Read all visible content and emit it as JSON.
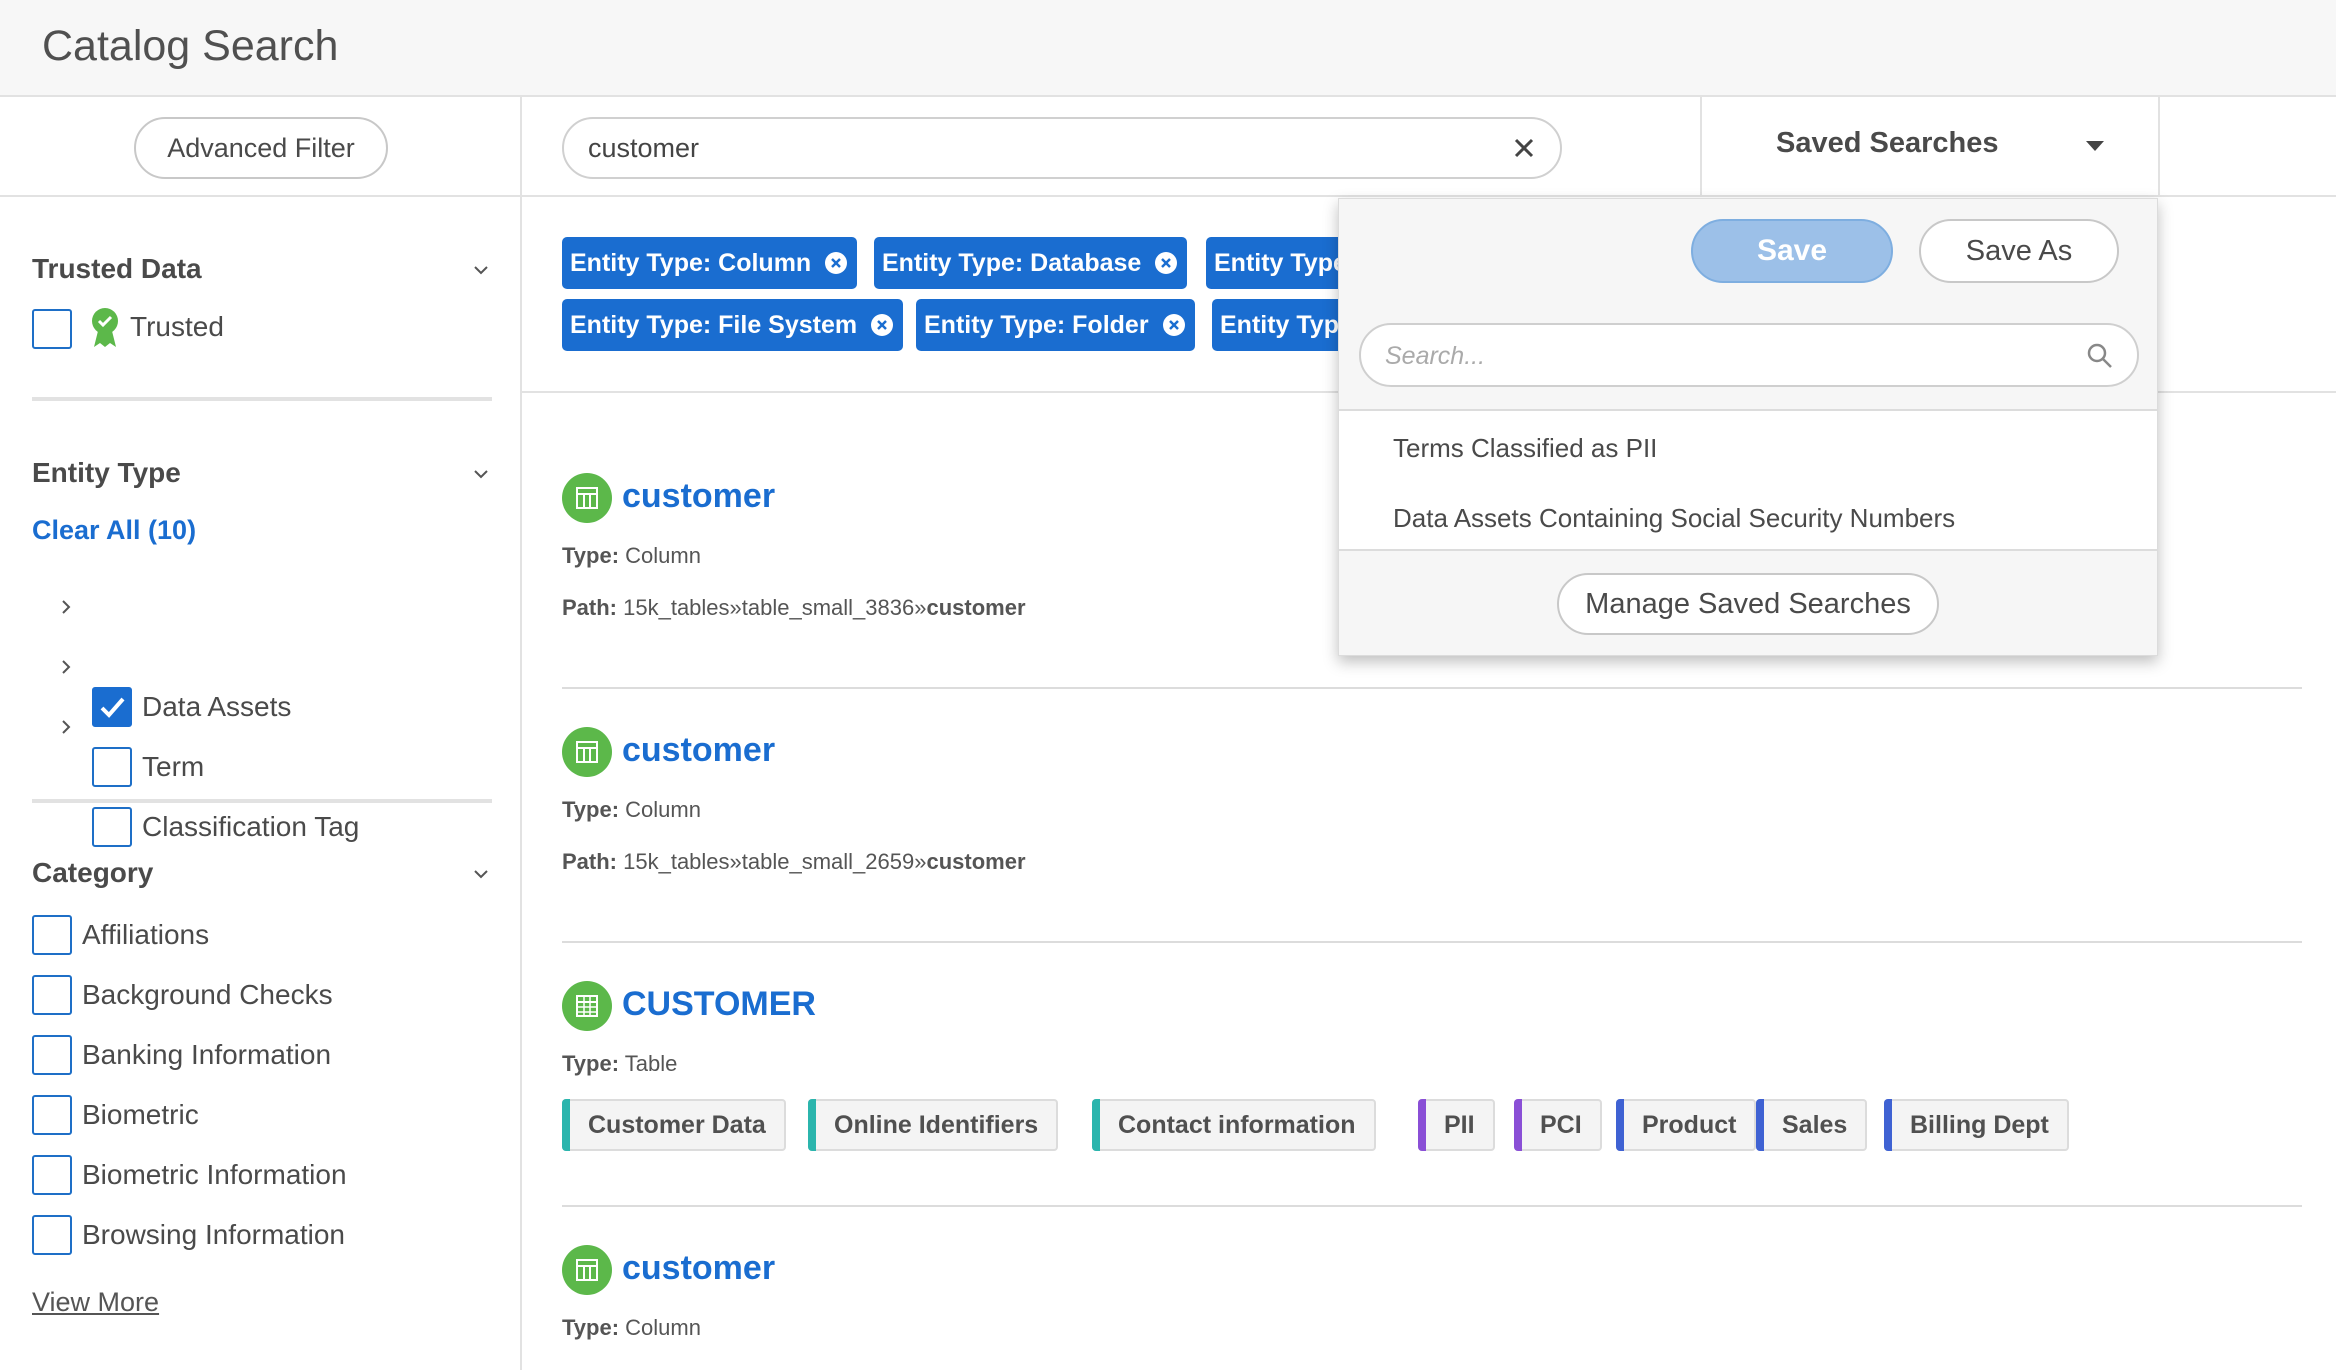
{
  "app": {
    "title": "Catalog Search"
  },
  "colors": {
    "accent": "#1a6dd0",
    "asset_green": "#5cb84a",
    "tag_teal": "#2bb5ad",
    "tag_purple": "#8a4fd6",
    "tag_blue": "#3f62d3"
  },
  "sidebar": {
    "advanced_filter_label": "Advanced Filter",
    "trusted": {
      "title": "Trusted Data",
      "option_label": "Trusted",
      "checked": false
    },
    "entity_type": {
      "title": "Entity Type",
      "clear_all_label": "Clear All (10)",
      "items": [
        {
          "label": "Data Assets",
          "checked": true
        },
        {
          "label": "Term",
          "checked": false
        },
        {
          "label": "Classification Tag",
          "checked": false
        }
      ]
    },
    "category": {
      "title": "Category",
      "items": [
        {
          "label": "Affiliations"
        },
        {
          "label": "Background Checks"
        },
        {
          "label": "Banking Information"
        },
        {
          "label": "Biometric"
        },
        {
          "label": "Biometric Information"
        },
        {
          "label": "Browsing Information"
        }
      ],
      "view_more_label": "View More"
    }
  },
  "search": {
    "value": "customer",
    "clear_icon": "close-icon"
  },
  "saved_searches": {
    "label": "Saved Searches",
    "save_label": "Save",
    "save_as_label": "Save As",
    "search_placeholder": "Search...",
    "items": [
      {
        "label": "Terms Classified as PII"
      },
      {
        "label": "Data Assets Containing Social Security Numbers"
      }
    ],
    "manage_label": "Manage Saved Searches"
  },
  "filter_chips": [
    {
      "label": "Entity Type: Column"
    },
    {
      "label": "Entity Type: Database"
    },
    {
      "label": "Entity Type"
    },
    {
      "label": "Entity Type: File System"
    },
    {
      "label": "Entity Type: Folder"
    },
    {
      "label": "Entity Typ"
    }
  ],
  "results": [
    {
      "title": "customer",
      "type_label": "Type:",
      "type_value": "Column",
      "path_label": "Path:",
      "path_prefix": "15k_tables»table_small_3836»",
      "path_leaf": "customer",
      "icon": "column-icon"
    },
    {
      "title": "customer",
      "type_label": "Type:",
      "type_value": "Column",
      "path_label": "Path:",
      "path_prefix": "15k_tables»table_small_2659»",
      "path_leaf": "customer",
      "icon": "column-icon"
    },
    {
      "title": "CUSTOMER",
      "type_label": "Type:",
      "type_value": "Table",
      "icon": "table-icon",
      "tags": [
        {
          "label": "Customer Data",
          "color": "#2bb5ad"
        },
        {
          "label": "Online Identifiers",
          "color": "#2bb5ad"
        },
        {
          "label": "Contact information",
          "color": "#2bb5ad"
        },
        {
          "label": "PII",
          "color": "#8a4fd6"
        },
        {
          "label": "PCI",
          "color": "#8a4fd6"
        },
        {
          "label": "Product",
          "color": "#3f62d3"
        },
        {
          "label": "Sales",
          "color": "#3f62d3"
        },
        {
          "label": "Billing Dept",
          "color": "#3f62d3"
        }
      ]
    },
    {
      "title": "customer",
      "type_label": "Type:",
      "type_value": "Column",
      "icon": "column-icon"
    }
  ]
}
